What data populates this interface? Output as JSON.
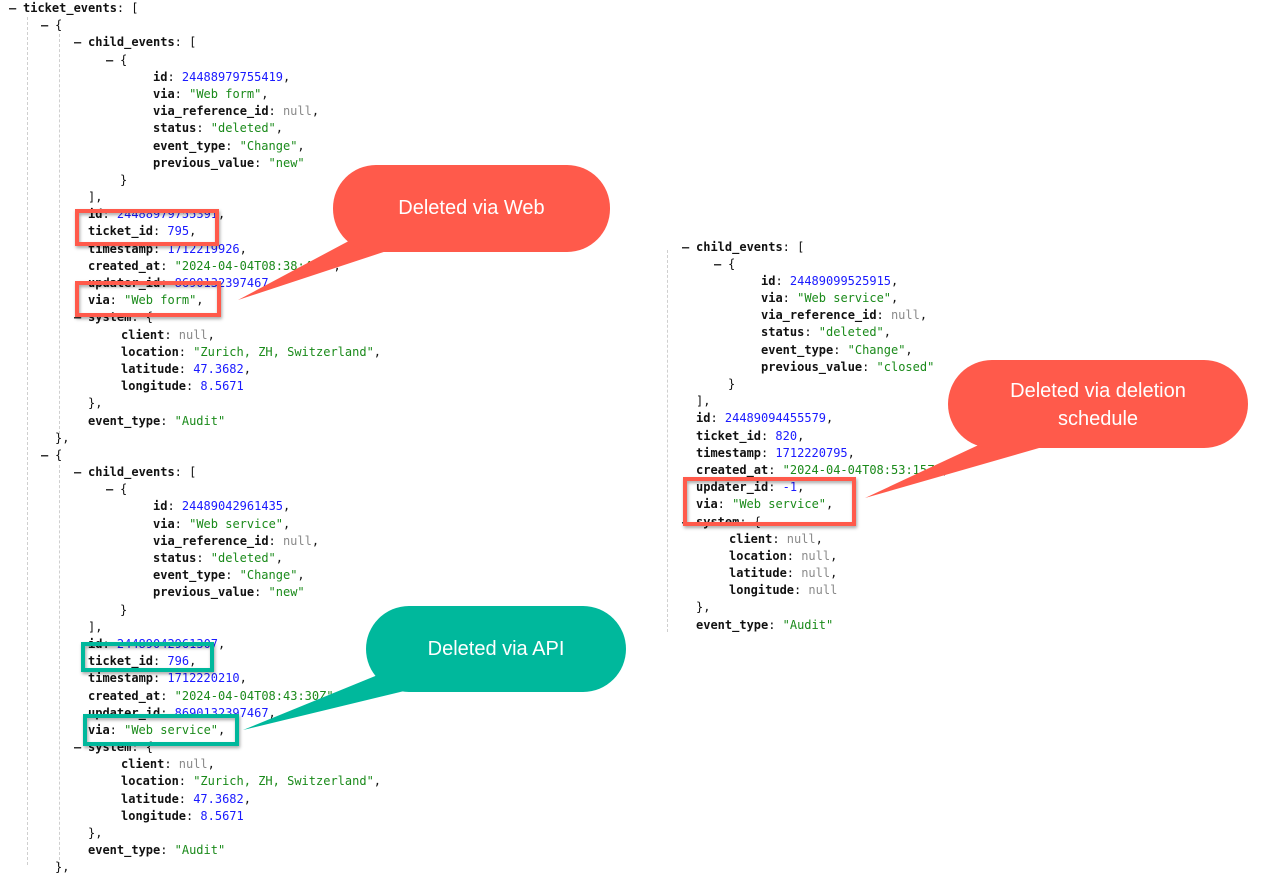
{
  "left_tree": {
    "root_key": "ticket_events",
    "items": [
      {
        "child_events": [
          {
            "id": 24488979755419,
            "via": "Web form",
            "via_reference_id": null,
            "status": "deleted",
            "event_type": "Change",
            "previous_value": "new"
          }
        ],
        "id": 24488979755391,
        "ticket_id": 795,
        "timestamp": 1712219926,
        "created_at": "2024-04-04T08:38:46Z",
        "updater_id": 8690132397467,
        "via": "Web form",
        "system": {
          "client": null,
          "location": "Zurich, ZH, Switzerland",
          "latitude": 47.3682,
          "longitude": 8.5671
        },
        "event_type": "Audit"
      },
      {
        "child_events": [
          {
            "id": 24489042961435,
            "via": "Web service",
            "via_reference_id": null,
            "status": "deleted",
            "event_type": "Change",
            "previous_value": "new"
          }
        ],
        "id": 24489042961307,
        "ticket_id": 796,
        "timestamp": 1712220210,
        "created_at": "2024-04-04T08:43:30Z",
        "updater_id": 8690132397467,
        "via": "Web service",
        "system": {
          "client": null,
          "location": "Zurich, ZH, Switzerland",
          "latitude": 47.3682,
          "longitude": 8.5671
        },
        "event_type": "Audit"
      }
    ]
  },
  "right_tree": {
    "child_events": [
      {
        "id": 24489099525915,
        "via": "Web service",
        "via_reference_id": null,
        "status": "deleted",
        "event_type": "Change",
        "previous_value": "closed"
      }
    ],
    "id": 24489094455579,
    "ticket_id": 820,
    "timestamp": 1712220795,
    "created_at": "2024-04-04T08:53:15Z",
    "updater_id": -1,
    "via": "Web service",
    "system": {
      "client": null,
      "location": null,
      "latitude": null,
      "longitude": null
    },
    "event_type": "Audit"
  },
  "annotations": {
    "web": "Deleted via Web",
    "api": "Deleted via API",
    "schedule_line1": "Deleted via deletion",
    "schedule_line2": "schedule"
  },
  "colors": {
    "callout_red": "#FF5A4B",
    "callout_teal": "#00B89C",
    "key": "#111111",
    "number": "#1a1aff",
    "string": "#1a8a1a",
    "null": "#8a8a8a"
  }
}
